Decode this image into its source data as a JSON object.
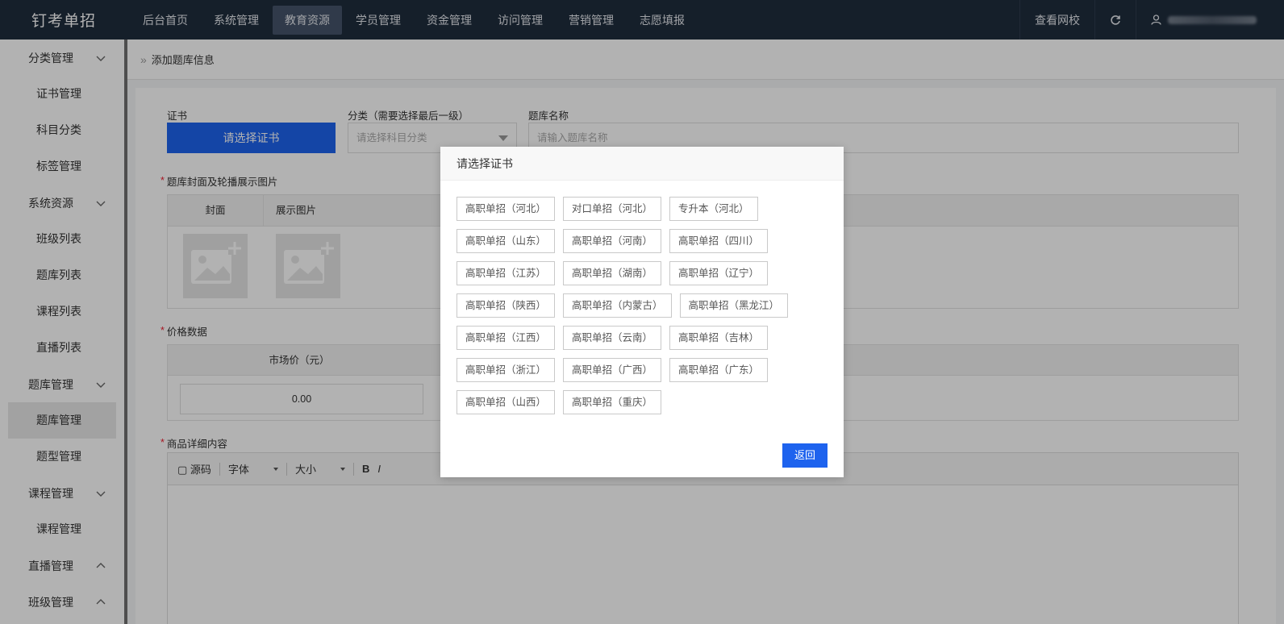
{
  "brand": "钉考单招",
  "nav": {
    "items": [
      "后台首页",
      "系统管理",
      "教育资源",
      "学员管理",
      "资金管理",
      "访问管理",
      "营销管理",
      "志愿填报"
    ],
    "active_index": 2,
    "view_school": "查看网校"
  },
  "sidebar": {
    "g1": "分类管理",
    "i1": "证书管理",
    "i2": "科目分类",
    "i3": "标签管理",
    "g2": "系统资源",
    "i4": "班级列表",
    "i5": "题库列表",
    "i6": "课程列表",
    "i7": "直播列表",
    "g3": "题库管理",
    "i8": "题库管理",
    "i9": "题型管理",
    "g4": "课程管理",
    "i10": "课程管理",
    "g5": "直播管理",
    "g6": "班级管理"
  },
  "breadcrumb": "添加题库信息",
  "form": {
    "cert_label": "证书",
    "cert_button": "请选择证书",
    "category_label": "分类（需要选择最后一级）",
    "category_placeholder": "请选择科目分类",
    "name_label": "题库名称",
    "name_placeholder": "请输入题库名称",
    "images_label": "题库封面及轮播展示图片",
    "cover_col": "封面",
    "display_col": "展示图片",
    "price_label": "价格数据",
    "market_price_col": "市场价（元）",
    "market_price_value": "0.00",
    "detail_label": "商品详细内容",
    "editor_source": "源码",
    "editor_font": "字体",
    "editor_size": "大小"
  },
  "modal": {
    "title": "请选择证书",
    "certs": [
      "高职单招（河北）",
      "对口单招（河北）",
      "专升本（河北）",
      "高职单招（山东）",
      "高职单招（河南）",
      "高职单招（四川）",
      "高职单招（江苏）",
      "高职单招（湖南）",
      "高职单招（辽宁）",
      "高职单招（陕西）",
      "高职单招（内蒙古）",
      "高职单招（黑龙江）",
      "高职单招（江西）",
      "高职单招（云南）",
      "高职单招（吉林）",
      "高职单招（浙江）",
      "高职单招（广西）",
      "高职单招（广东）",
      "高职单招（山西）",
      "高职单招（重庆）"
    ],
    "back_button": "返回"
  },
  "colors": {
    "primary": "#1e63ee",
    "topbar": "#1f2d3d"
  }
}
